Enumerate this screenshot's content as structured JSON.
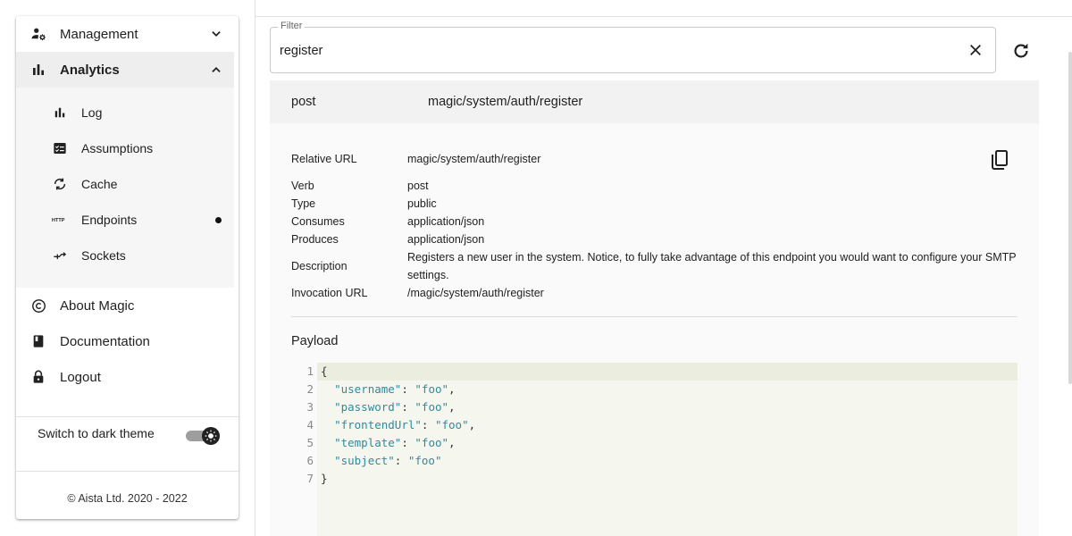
{
  "sidebar": {
    "items": [
      {
        "label": "Management",
        "icon": "manage-accounts-icon",
        "expanded": false
      },
      {
        "label": "Analytics",
        "icon": "bar-chart-icon",
        "expanded": true
      }
    ],
    "analytics_items": [
      {
        "label": "Log",
        "icon": "bar-chart-icon"
      },
      {
        "label": "Assumptions",
        "icon": "fact-check-icon"
      },
      {
        "label": "Cache",
        "icon": "cached-icon"
      },
      {
        "label": "Endpoints",
        "icon": "http-icon",
        "active": true
      },
      {
        "label": "Sockets",
        "icon": "call-merge-icon"
      }
    ],
    "bottom_items": [
      {
        "label": "About Magic",
        "icon": "copyright-icon"
      },
      {
        "label": "Documentation",
        "icon": "book-icon"
      },
      {
        "label": "Logout",
        "icon": "lock-icon"
      }
    ],
    "theme_label": "Switch to dark theme",
    "copyright": "© Aista Ltd. 2020 - 2022"
  },
  "filter": {
    "label": "Filter",
    "value": "register"
  },
  "endpoint": {
    "verb": "post",
    "url": "magic/system/auth/register",
    "details": {
      "relative_url_label": "Relative URL",
      "relative_url": "magic/system/auth/register",
      "verb_label": "Verb",
      "verb": "post",
      "type_label": "Type",
      "type": "public",
      "consumes_label": "Consumes",
      "consumes": "application/json",
      "produces_label": "Produces",
      "produces": "application/json",
      "description_label": "Description",
      "description_line1": "Registers a new user in the system. Notice, to fully take advantage of this endpoint you would want to configure your SMTP",
      "description_line2": "settings.",
      "invocation_url_label": "Invocation URL",
      "invocation_url": "/magic/system/auth/register"
    },
    "payload_title": "Payload",
    "payload_lines": [
      {
        "n": "1",
        "text": "{"
      },
      {
        "n": "2",
        "key": "\"username\"",
        "value": "\"foo\"",
        "trail": ","
      },
      {
        "n": "3",
        "key": "\"password\"",
        "value": "\"foo\"",
        "trail": ","
      },
      {
        "n": "4",
        "key": "\"frontendUrl\"",
        "value": "\"foo\"",
        "trail": ","
      },
      {
        "n": "5",
        "key": "\"template\"",
        "value": "\"foo\"",
        "trail": ","
      },
      {
        "n": "6",
        "key": "\"subject\"",
        "value": "\"foo\"",
        "trail": ""
      },
      {
        "n": "7",
        "text": "}"
      }
    ]
  }
}
